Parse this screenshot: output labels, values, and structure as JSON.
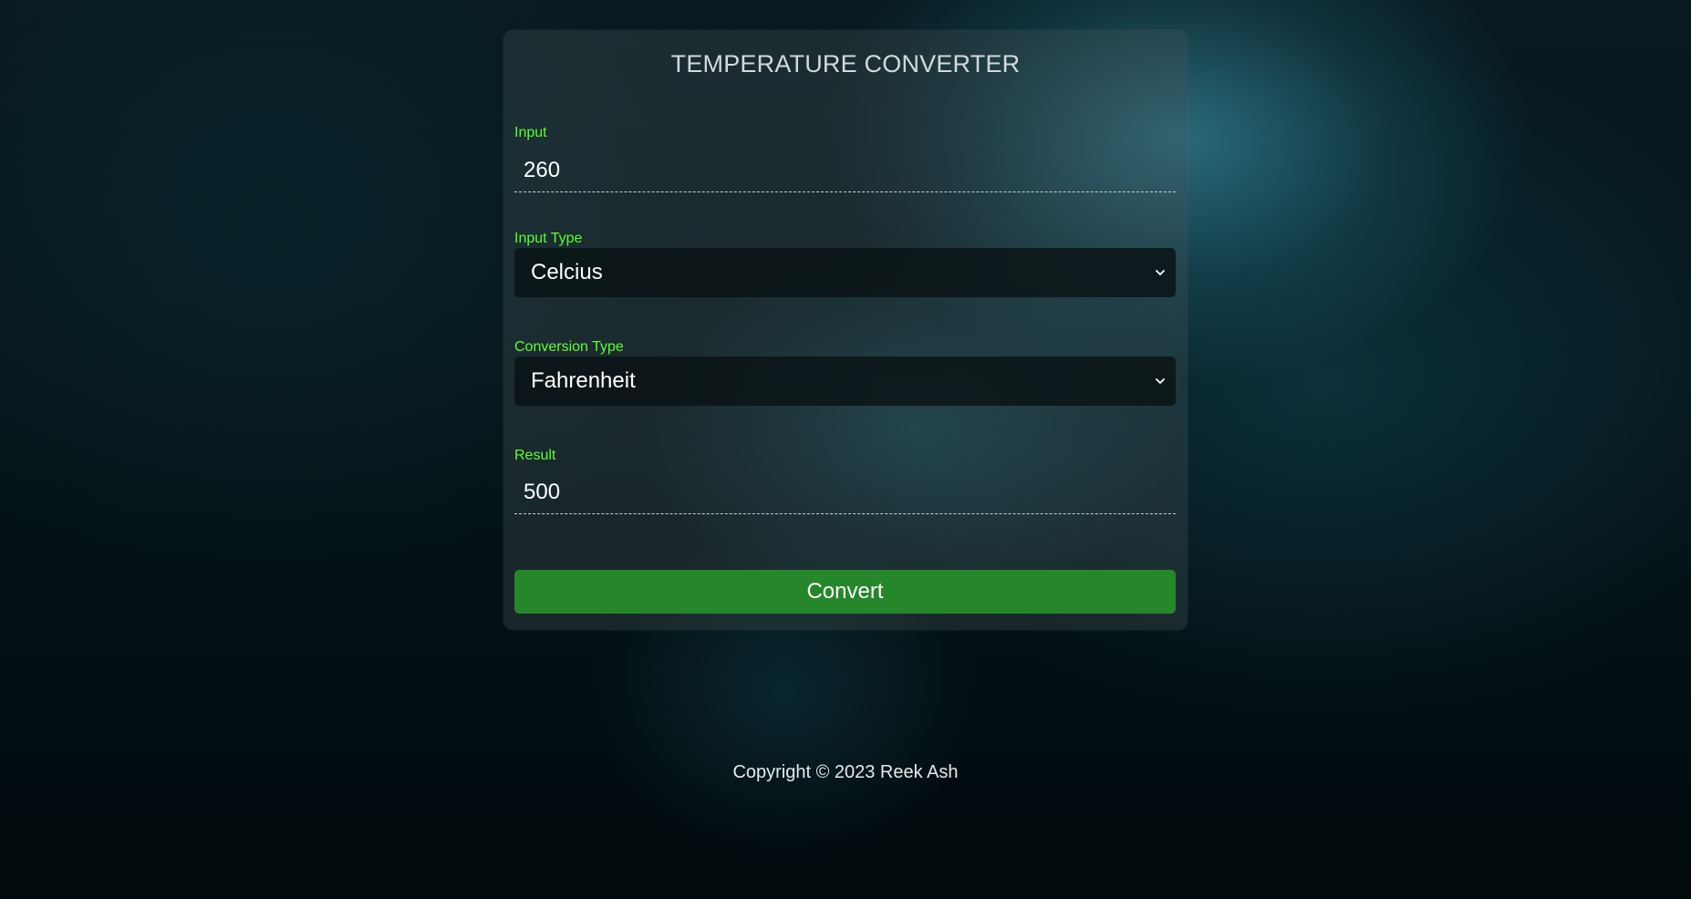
{
  "card": {
    "title": "TEMPERATURE CONVERTER",
    "input": {
      "label": "Input",
      "value": "260"
    },
    "input_type": {
      "label": "Input Type",
      "selected": "Celcius",
      "icon": "chevron-down-icon"
    },
    "conversion_type": {
      "label": "Conversion Type",
      "selected": "Fahrenheit",
      "icon": "chevron-down-icon"
    },
    "result": {
      "label": "Result",
      "value": "500"
    },
    "convert_label": "Convert"
  },
  "footer": {
    "copyright": "Copyright © 2023 Reek Ash"
  },
  "colors": {
    "label": "#5cff2f",
    "button": "#26862a",
    "text": "#ffffff"
  }
}
